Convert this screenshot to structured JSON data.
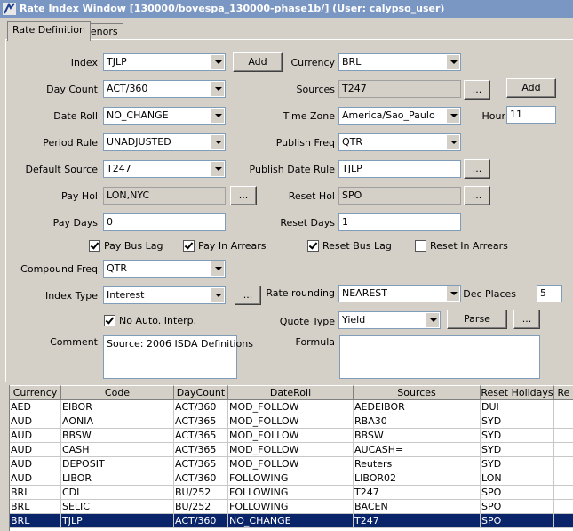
{
  "window": {
    "title": "Rate Index Window  [130000/bovespa_130000-phase1b/] (User: calypso_user)"
  },
  "tabs": [
    "Rate Definition",
    "Tenors"
  ],
  "form": {
    "index": {
      "label": "Index",
      "value": "TJLP"
    },
    "add_index_label": "Add",
    "currency": {
      "label": "Currency",
      "value": "BRL"
    },
    "day_count": {
      "label": "Day Count",
      "value": "ACT/360"
    },
    "sources": {
      "label": "Sources",
      "value": "T247"
    },
    "sources_more": "...",
    "add_sources_label": "Add",
    "date_roll": {
      "label": "Date Roll",
      "value": "NO_CHANGE"
    },
    "time_zone": {
      "label": "Time Zone",
      "value": "America/Sao_Paulo"
    },
    "hour": {
      "label": "Hour",
      "value": "11"
    },
    "period_rule": {
      "label": "Period Rule",
      "value": "UNADJUSTED"
    },
    "publish_freq": {
      "label": "Publish Freq",
      "value": "QTR"
    },
    "default_source": {
      "label": "Default Source",
      "value": "T247"
    },
    "publish_date_rule": {
      "label": "Publish Date Rule",
      "value": "TJLP"
    },
    "publish_date_rule_more": "...",
    "pay_hol": {
      "label": "Pay Hol",
      "value": "LON,NYC"
    },
    "pay_hol_more": "...",
    "reset_hol": {
      "label": "Reset Hol",
      "value": "SPO"
    },
    "reset_hol_more": "...",
    "pay_days": {
      "label": "Pay Days",
      "value": "0"
    },
    "reset_days": {
      "label": "Reset Days",
      "value": "1"
    },
    "checks": {
      "pay_bus_lag": {
        "label": "Pay Bus Lag",
        "checked": true
      },
      "pay_in_arrears": {
        "label": "Pay In Arrears",
        "checked": true
      },
      "reset_bus_lag": {
        "label": "Reset Bus Lag",
        "checked": true
      },
      "reset_in_arrears": {
        "label": "Reset In Arrears",
        "checked": false
      },
      "no_auto_interp": {
        "label": "No Auto. Interp.",
        "checked": true
      }
    },
    "compound_freq": {
      "label": "Compound Freq",
      "value": "QTR"
    },
    "index_type": {
      "label": "Index Type",
      "value": "Interest"
    },
    "index_type_more": "...",
    "rate_rounding": {
      "label": "Rate rounding",
      "value": "NEAREST"
    },
    "dec_places": {
      "label": "Dec Places",
      "value": "5"
    },
    "quote_type": {
      "label": "Quote Type",
      "value": "Yield"
    },
    "parse_label": "Parse",
    "quote_type_more": "...",
    "comment": {
      "label": "Comment",
      "value": "Source: 2006 ISDA Definitions"
    },
    "formula": {
      "label": "Formula",
      "value": ""
    }
  },
  "table": {
    "columns": [
      "Currency",
      "Code",
      "DayCount",
      "DateRoll",
      "Sources",
      "Reset Holidays",
      "Re"
    ],
    "rows": [
      [
        "AED",
        "EIBOR",
        "ACT/360",
        "MOD_FOLLOW",
        "AEDEIBOR",
        "DUI",
        ""
      ],
      [
        "AUD",
        "AONIA",
        "ACT/365",
        "MOD_FOLLOW",
        "RBA30",
        "SYD",
        ""
      ],
      [
        "AUD",
        "BBSW",
        "ACT/365",
        "MOD_FOLLOW",
        "BBSW",
        "SYD",
        ""
      ],
      [
        "AUD",
        "CASH",
        "ACT/365",
        "MOD_FOLLOW",
        "AUCASH=",
        "SYD",
        ""
      ],
      [
        "AUD",
        "DEPOSIT",
        "ACT/365",
        "MOD_FOLLOW",
        "Reuters",
        "SYD",
        ""
      ],
      [
        "AUD",
        "LIBOR",
        "ACT/360",
        "FOLLOWING",
        "LIBOR02",
        "LON",
        ""
      ],
      [
        "BRL",
        "CDI",
        "BU/252",
        "FOLLOWING",
        "T247",
        "SPO",
        ""
      ],
      [
        "BRL",
        "SELIC",
        "BU/252",
        "FOLLOWING",
        "BACEN",
        "SPO",
        ""
      ],
      [
        "BRL",
        "TJLP",
        "ACT/360",
        "NO_CHANGE",
        "T247",
        "SPO",
        ""
      ]
    ],
    "selected_row": 8
  }
}
